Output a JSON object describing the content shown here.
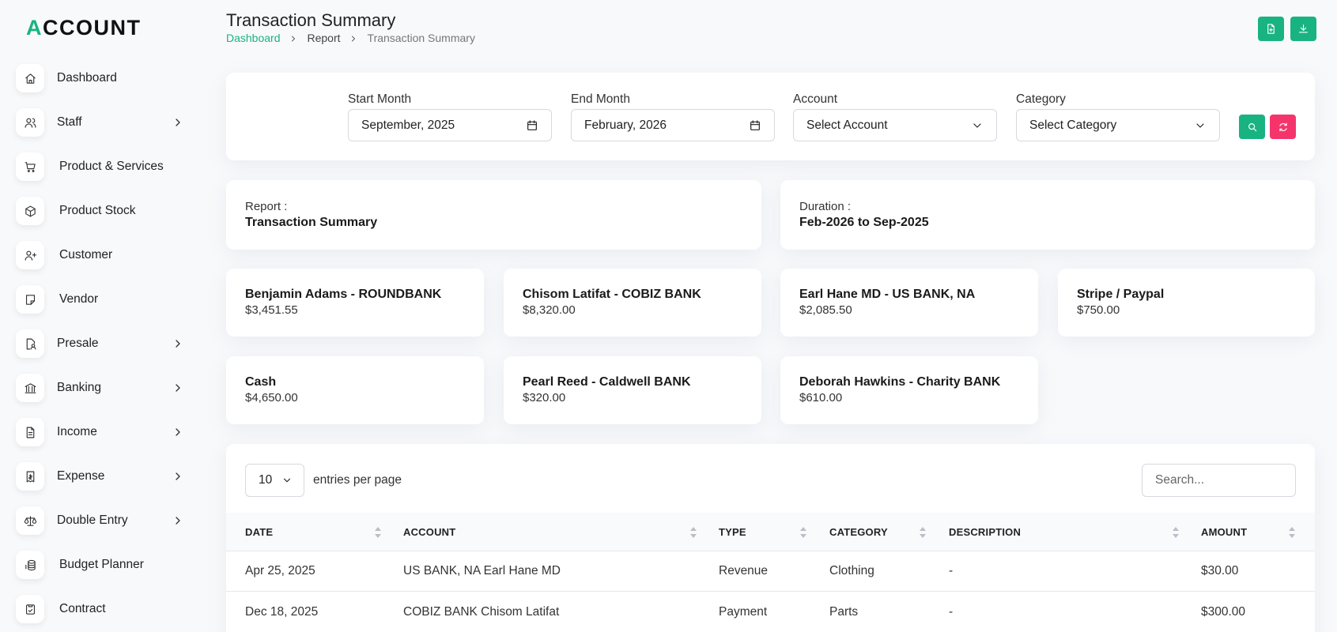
{
  "app": {
    "logo_accent": "A",
    "logo_rest": "CCOUNT",
    "accent_color": "#19b382",
    "danger_color": "#f5346b"
  },
  "sidebar": {
    "items": [
      {
        "label": "Dashboard",
        "icon": "home-icon"
      },
      {
        "label": "Staff",
        "icon": "users-icon",
        "has_children": true
      },
      {
        "label": "Product & Services",
        "icon": "cart-icon"
      },
      {
        "label": "Product Stock",
        "icon": "box-icon"
      },
      {
        "label": "Customer",
        "icon": "user-plus-icon"
      },
      {
        "label": "Vendor",
        "icon": "note-icon"
      },
      {
        "label": "Presale",
        "icon": "file-user-icon",
        "has_children": true
      },
      {
        "label": "Banking",
        "icon": "bank-icon",
        "has_children": true
      },
      {
        "label": "Income",
        "icon": "file-text-icon",
        "has_children": true
      },
      {
        "label": "Expense",
        "icon": "receipt-icon",
        "has_children": true
      },
      {
        "label": "Double Entry",
        "icon": "scale-icon",
        "has_children": true
      },
      {
        "label": "Budget Planner",
        "icon": "coins-icon"
      },
      {
        "label": "Contract",
        "icon": "contract-icon"
      }
    ]
  },
  "header": {
    "title": "Transaction Summary",
    "breadcrumb": [
      "Dashboard",
      "Report",
      "Transaction Summary"
    ],
    "actions": [
      {
        "icon": "file-export-icon"
      },
      {
        "icon": "download-icon"
      }
    ]
  },
  "filters": {
    "start_month": {
      "label": "Start Month",
      "value": "September, 2025"
    },
    "end_month": {
      "label": "End Month",
      "value": "February, 2026"
    },
    "account": {
      "label": "Account",
      "value": "Select Account"
    },
    "category": {
      "label": "Category",
      "value": "Select Category"
    }
  },
  "report_info": {
    "report_key": "Report :",
    "report_value": "Transaction Summary",
    "duration_key": "Duration :",
    "duration_value": "Feb-2026 to Sep-2025"
  },
  "accounts": [
    {
      "name": "Benjamin Adams - ROUNDBANK",
      "amount": "$3,451.55"
    },
    {
      "name": "Chisom Latifat - COBIZ BANK",
      "amount": "$8,320.00"
    },
    {
      "name": "Earl Hane MD - US BANK, NA",
      "amount": "$2,085.50"
    },
    {
      "name": "Stripe / Paypal",
      "amount": "$750.00"
    },
    {
      "name": "Cash",
      "amount": "$4,650.00"
    },
    {
      "name": "Pearl Reed - Caldwell BANK",
      "amount": "$320.00"
    },
    {
      "name": "Deborah Hawkins - Charity BANK",
      "amount": "$610.00"
    }
  ],
  "table": {
    "page_size": "10",
    "entries_label": "entries per page",
    "search_placeholder": "Search...",
    "columns": [
      "DATE",
      "ACCOUNT",
      "TYPE",
      "CATEGORY",
      "DESCRIPTION",
      "AMOUNT"
    ],
    "rows": [
      [
        "Apr 25, 2025",
        "US BANK, NA Earl Hane MD",
        "Revenue",
        "Clothing",
        "-",
        "$30.00"
      ],
      [
        "Dec 18, 2025",
        "COBIZ BANK Chisom Latifat",
        "Payment",
        "Parts",
        "-",
        "$300.00"
      ]
    ]
  }
}
